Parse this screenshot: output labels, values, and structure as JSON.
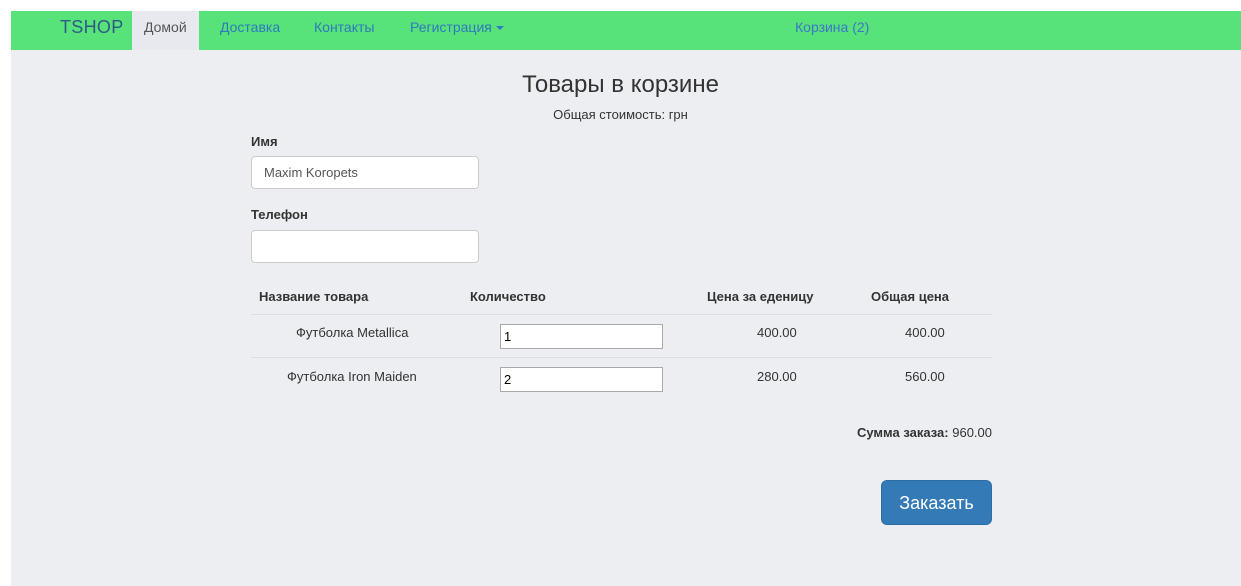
{
  "nav": {
    "brand": "TSHOP",
    "items": [
      "Домой",
      "Доставка",
      "Контакты",
      "Регистрация"
    ],
    "cart": "Корзина (2)"
  },
  "page": {
    "title": "Товары в корзине",
    "subtitle": "Общая стоимость: грн"
  },
  "form": {
    "name_label": "Имя",
    "name_value": "Maxim Koropets",
    "phone_label": "Телефон",
    "phone_value": ""
  },
  "table": {
    "headers": [
      "Название товара",
      "Количество",
      "Цена за еденицу",
      "Общая цена"
    ],
    "rows": [
      {
        "name": "Футболка Metallica",
        "qty": "1",
        "price": "400.00",
        "total": "400.00"
      },
      {
        "name": "Футболка Iron Maiden",
        "qty": "2",
        "price": "280.00",
        "total": "560.00"
      }
    ]
  },
  "summary": {
    "label": "Сумма заказа:",
    "value": "960.00"
  },
  "order_button": "Заказать"
}
